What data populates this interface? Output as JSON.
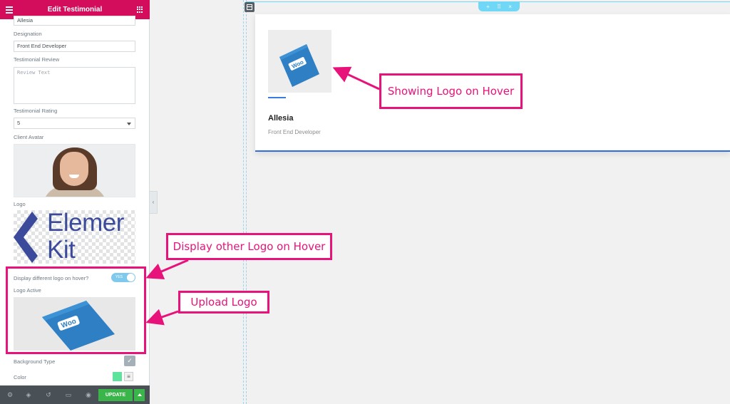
{
  "panel": {
    "title": "Edit Testimonial",
    "name_value": "Allesia",
    "designation_label": "Designation",
    "designation_value": "Front End Developer",
    "review_label": "Testimonial Review",
    "review_placeholder": "Review Text",
    "rating_label": "Testimonial Rating",
    "rating_value": "5",
    "avatar_label": "Client Avatar",
    "logo_label": "Logo",
    "logo_text_line1": "Elemer",
    "logo_text_line2": "Kit",
    "hover_toggle_label": "Display different logo on hover?",
    "hover_toggle_state": "YES",
    "logo_active_label": "Logo Active",
    "woo_text": "Woo",
    "background_type_label": "Background Type",
    "color_label": "Color",
    "color_swatch": "#5de39b"
  },
  "footer": {
    "update_label": "UPDATE"
  },
  "canvas": {
    "section_handle_icons": [
      "+",
      "⠿",
      "×"
    ],
    "card": {
      "name": "Allesia",
      "role": "Front End Developer",
      "logo_text": "Woo"
    }
  },
  "annotations": {
    "showing_logo": "Showing Logo on Hover",
    "display_other": "Display other Logo on Hover",
    "upload_logo": "Upload Logo"
  },
  "colors": {
    "brand": "#d30c5c",
    "annotation": "#e8127b",
    "update": "#39b54a",
    "accent_blue": "#3a7de0"
  }
}
